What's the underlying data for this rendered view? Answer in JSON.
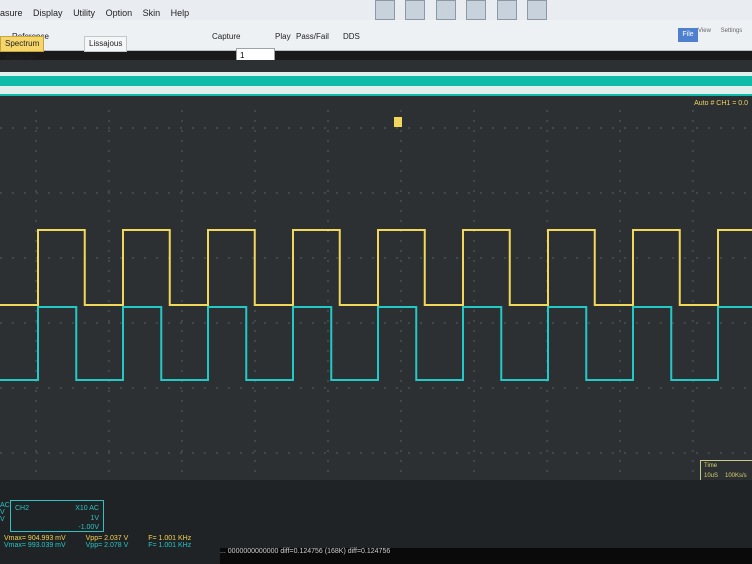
{
  "menu": {
    "items": [
      "asure",
      "Display",
      "Utility",
      "Option",
      "Skin",
      "Help"
    ]
  },
  "toolbar": {
    "reference_label": "Reference",
    "capture_label": "Capture",
    "capture_value": "1",
    "play_label": "Play",
    "pass_fail_label": "Pass/Fail",
    "dds_label": "DDS"
  },
  "tabs": [
    {
      "label": "Spectrum Analyzer",
      "active": true
    },
    {
      "label": "Lissajous",
      "active": false
    }
  ],
  "ribbon": {
    "file_label": "File",
    "items": [
      "View",
      "Settings"
    ]
  },
  "screen": {
    "auto_label": "Auto  # CH1  = 0.0",
    "time_box_label": "Time",
    "time_box_value1": "10uS",
    "time_box_value2": "100Ks/s"
  },
  "ch2": {
    "label": "CH2",
    "probe": "X10  AC",
    "scale": "1V",
    "offset": "-1.00V",
    "left_labels": [
      "AC",
      "V",
      "V"
    ]
  },
  "measurements": [
    {
      "color": "#f3d34d",
      "vmax": "Vmax= 904.993 mV",
      "vpp": "Vpp= 2.037 V",
      "freq": "F= 1.001 KHz"
    },
    {
      "color": "#27c6c3",
      "vmax": "Vmax= 993.039 mV",
      "vpp": "Vpp= 2.078 V",
      "freq": "F= 1.001 KHz"
    }
  ],
  "status_text": "...  0000000000000    diff=0.124756   (168K)    diff=0.124756",
  "colors": {
    "ch1": "#f2d85a",
    "ch2": "#23c9c7",
    "grid": "#546068",
    "screen_bg": "#2c3033"
  }
}
